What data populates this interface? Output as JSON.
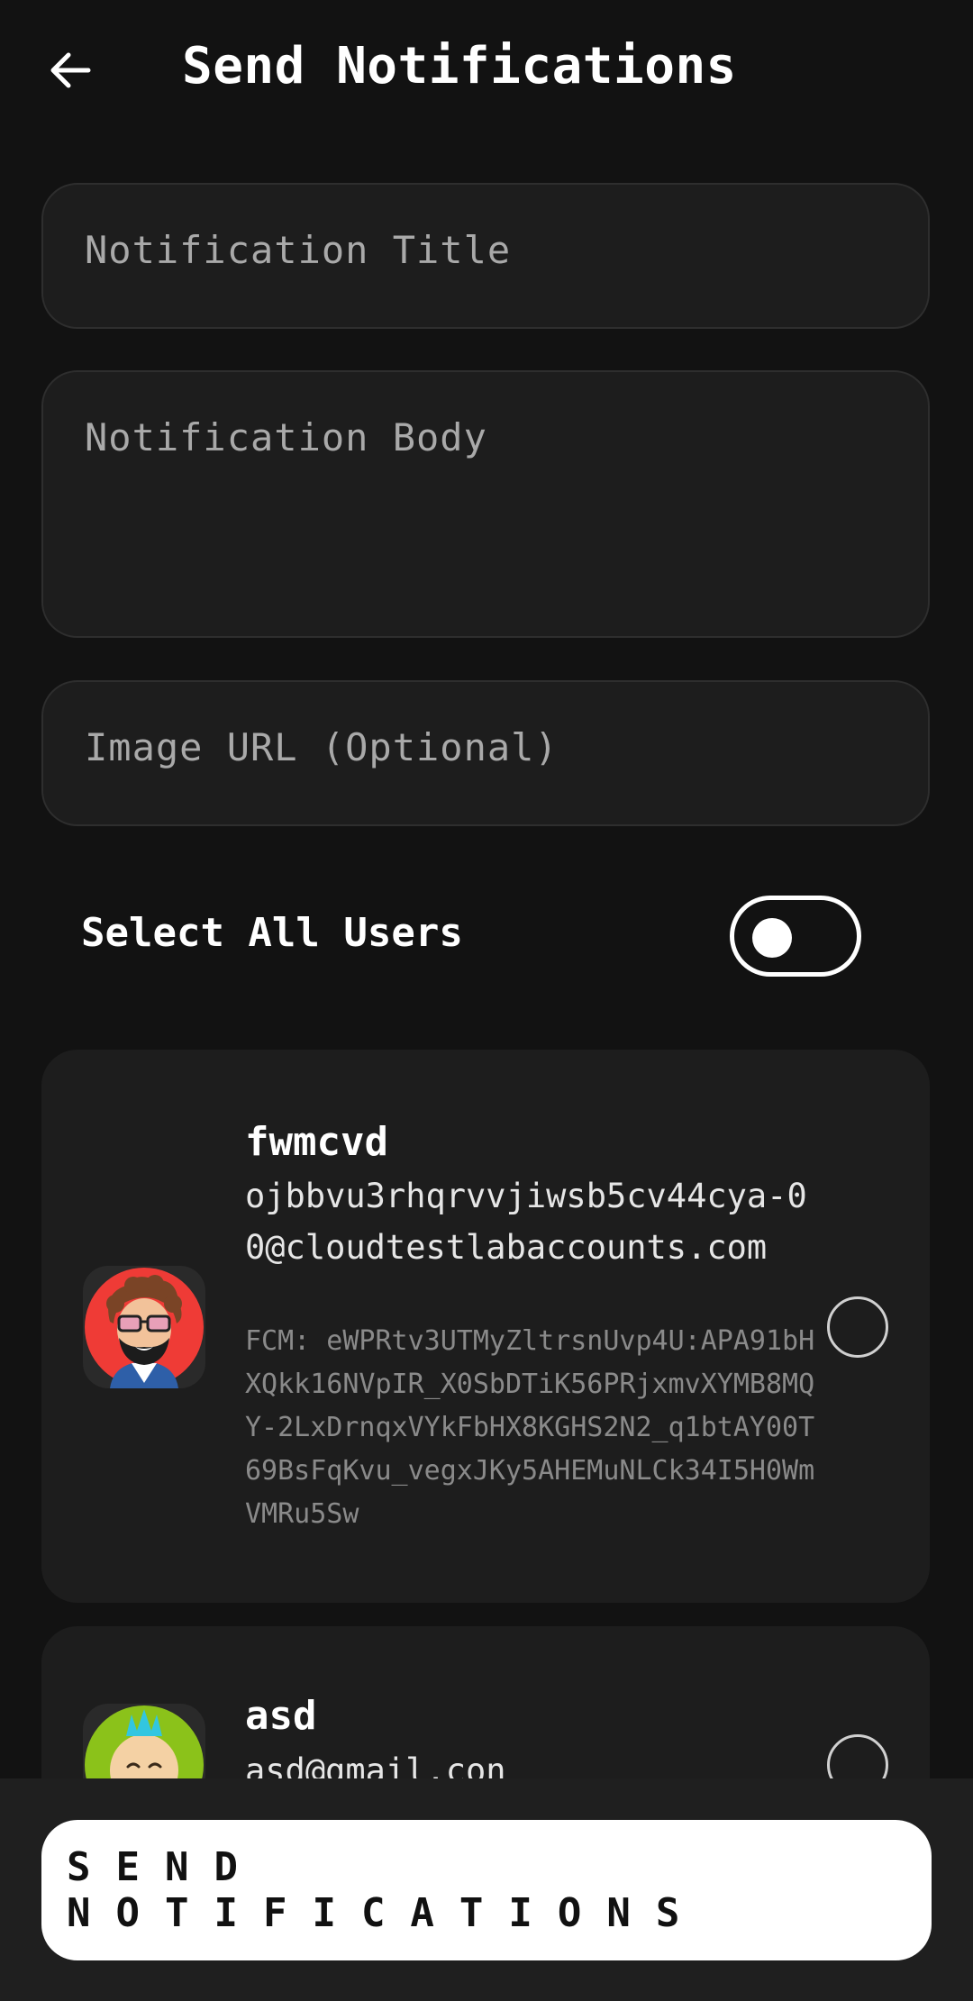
{
  "header": {
    "title": "Send Notifications",
    "back_icon": "arrow-left-icon"
  },
  "form": {
    "title_placeholder": "Notification Title",
    "title_value": "",
    "body_placeholder": "Notification Body",
    "body_value": "",
    "image_url_placeholder": "Image URL (Optional)",
    "image_url_value": ""
  },
  "select_all": {
    "label": "Select All Users",
    "enabled": false
  },
  "users": [
    {
      "name": "fwmcvd",
      "email": "ojbbvu3rhqrvvjiwsb5cv44cya-00@cloudtestlabaccounts.com",
      "fcm": "FCM: eWPRtv3UTMyZltrsnUvp4U:APA91bHXQkk16NVpIR_X0SbDTiK56PRjxmvXYMB8MQY-2LxDrnqxVYkFbHX8KGHS2N2_q1btAY00T69BsFqKvu_vegxJKy5AHEMuNLCk34I5H0WmVMRu5Sw",
      "selected": false,
      "avatar_icon": "bearded-man-sunglasses-avatar"
    },
    {
      "name": "asd",
      "email": "asd@gmail.con",
      "selected": false,
      "avatar_icon": "mohawk-kid-avatar"
    }
  ],
  "footer": {
    "send_label": "SEND NOTIFICATIONS"
  },
  "colors": {
    "background": "#121212",
    "surface": "#1d1d1d",
    "button": "#ffffff"
  }
}
